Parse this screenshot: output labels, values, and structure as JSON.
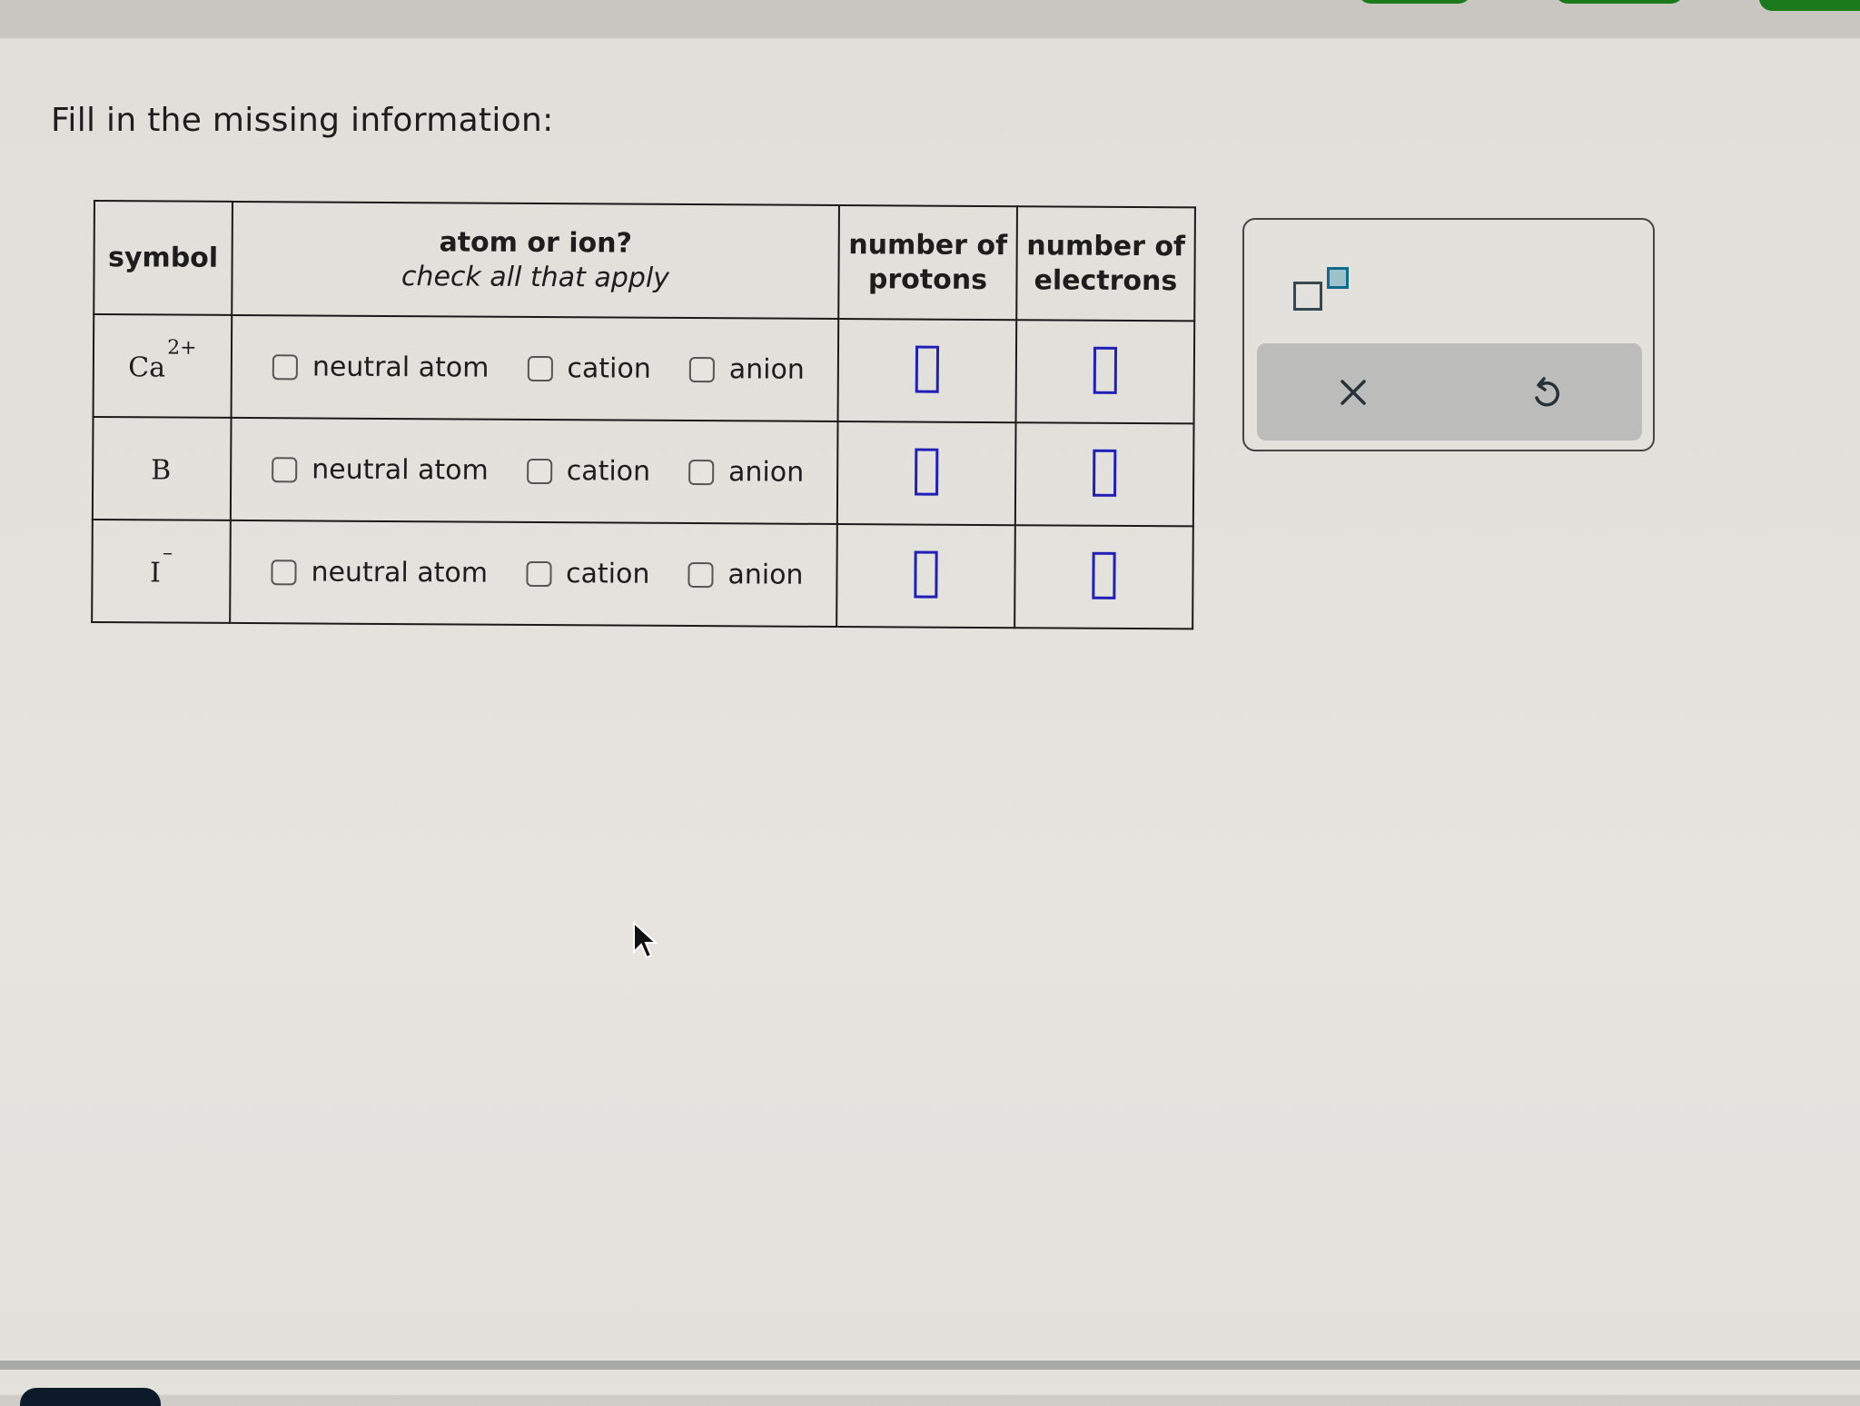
{
  "prompt": "Fill in the missing information:",
  "table": {
    "headers": {
      "symbol": "symbol",
      "atom_or_ion": "atom or ion?",
      "atom_or_ion_hint": "check all that apply",
      "protons_line1": "number of",
      "protons_line2": "protons",
      "electrons_line1": "number of",
      "electrons_line2": "electrons"
    },
    "option_labels": [
      "neutral atom",
      "cation",
      "anion"
    ],
    "rows": [
      {
        "element": "Ca",
        "charge": "2+",
        "options": [
          {
            "label": "neutral atom",
            "checked": false
          },
          {
            "label": "cation",
            "checked": false
          },
          {
            "label": "anion",
            "checked": false
          }
        ],
        "protons": "",
        "electrons": ""
      },
      {
        "element": "B",
        "charge": "",
        "options": [
          {
            "label": "neutral atom",
            "checked": false
          },
          {
            "label": "cation",
            "checked": false
          },
          {
            "label": "anion",
            "checked": false
          }
        ],
        "protons": "",
        "electrons": ""
      },
      {
        "element": "I",
        "charge": "–",
        "options": [
          {
            "label": "neutral atom",
            "checked": false
          },
          {
            "label": "cation",
            "checked": false
          },
          {
            "label": "anion",
            "checked": false
          }
        ],
        "protons": "",
        "electrons": ""
      }
    ]
  },
  "tool_panel": {
    "tools": [
      {
        "icon": "superscript-icon"
      }
    ],
    "actions": [
      {
        "icon": "close-icon"
      },
      {
        "icon": "undo-icon"
      }
    ]
  },
  "colors": {
    "answer_box": "#2020b8",
    "superscript_accent": "#0e6b8a",
    "tab_green": "#1b7a1b",
    "action_bar": "#bcbcba"
  }
}
